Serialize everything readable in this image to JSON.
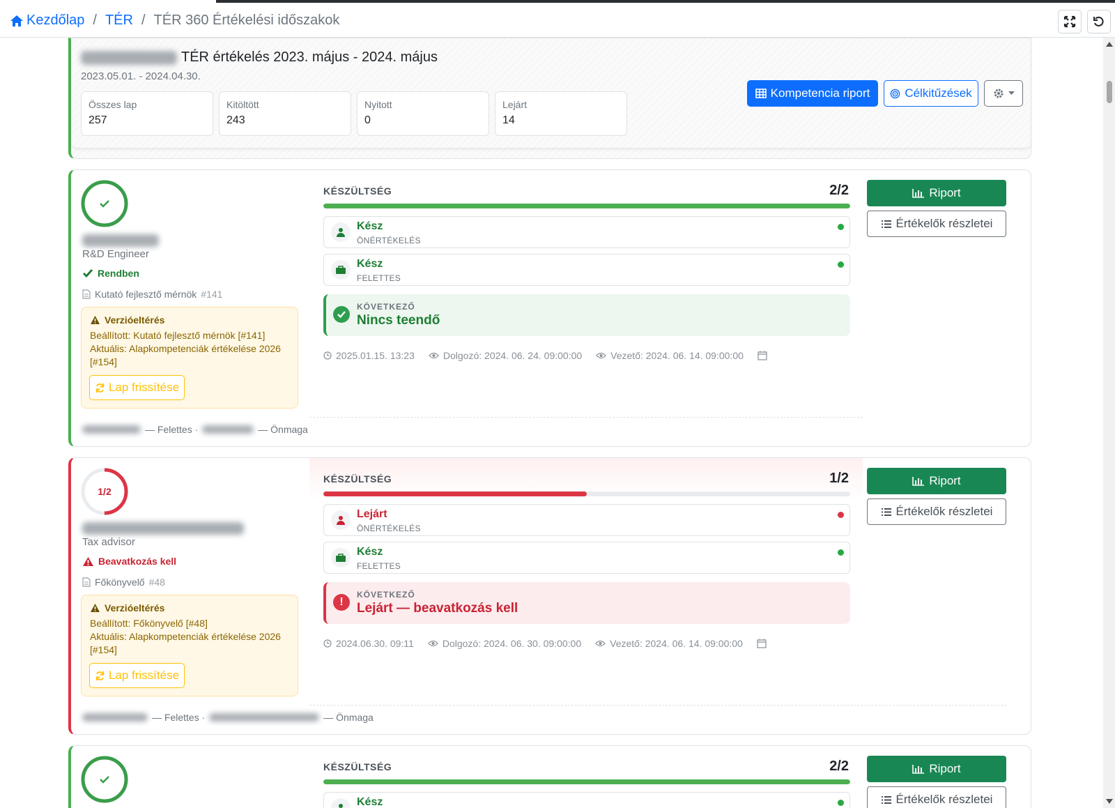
{
  "breadcrumb": {
    "home": "Kezdőlap",
    "ter": "TÉR",
    "current": "TÉR 360 Értékelési időszakok"
  },
  "period": {
    "title": "TÉR értékelés 2023. május - 2024. május",
    "dates": "2023.05.01. - 2024.04.30.",
    "stats": [
      {
        "label": "Összes lap",
        "value": "257"
      },
      {
        "label": "Kitöltött",
        "value": "243"
      },
      {
        "label": "Nyitott",
        "value": "0"
      },
      {
        "label": "Lejárt",
        "value": "14"
      }
    ],
    "competency_button": "Kompetencia riport",
    "goals_button": "Célkitűzések"
  },
  "cards": [
    {
      "ring_text": "",
      "progress_fraction": 1.0,
      "role": "R&D Engineer",
      "status": "Rendben",
      "sheet_name": "Kutató fejlesztő mérnök",
      "sheet_num": "#141",
      "warning_title": "Verzióeltérés",
      "warning_set": "Beállított: Kutató fejlesztő mérnök [#141]",
      "warning_current": "Aktuális: Alapkompetenciák értékelése 2026 [#154]",
      "refresh_label": "Lap frissítése",
      "footer_sup": "— Felettes ·",
      "footer_self": "— Önmaga",
      "readiness_label": "KÉSZÜLTSÉG",
      "readiness_count": "2/2",
      "steps": [
        {
          "status": "Kész",
          "type": "ÖNÉRTÉKELÉS"
        },
        {
          "status": "Kész",
          "type": "FELETTES"
        }
      ],
      "next_label": "KÖVETKEZŐ",
      "next_value": "Nincs teendő",
      "meta_updated": "2025.01.15. 13:23",
      "meta_employee": "Dolgozó:  2024. 06. 24. 09:00:00",
      "meta_manager": "Vezető:  2024. 06. 14. 09:00:00",
      "report_button": "Riport",
      "evaluators_button": "Értékelők részletei"
    },
    {
      "ring_text": "1/2",
      "progress_fraction": 0.5,
      "role": "Tax advisor",
      "status": "Beavatkozás kell",
      "sheet_name": "Főkönyvelő",
      "sheet_num": "#48",
      "warning_title": "Verzióeltérés",
      "warning_set": "Beállított: Főkönyvelő [#48]",
      "warning_current": "Aktuális: Alapkompetenciák értékelése 2026 [#154]",
      "refresh_label": "Lap frissítése",
      "footer_sup": "— Felettes ·",
      "footer_self": "— Önmaga",
      "readiness_label": "KÉSZÜLTSÉG",
      "readiness_count": "1/2",
      "steps": [
        {
          "status": "Lejárt",
          "type": "ÖNÉRTÉKELÉS"
        },
        {
          "status": "Kész",
          "type": "FELETTES"
        }
      ],
      "next_label": "KÖVETKEZŐ",
      "next_value": "Lejárt — beavatkozás kell",
      "meta_updated": "2024.06.30. 09:11",
      "meta_employee": "Dolgozó:  2024. 06. 30. 09:00:00",
      "meta_manager": "Vezető:  2024. 06. 14. 09:00:00",
      "report_button": "Riport",
      "evaluators_button": "Értékelők részletei"
    },
    {
      "ring_text": "",
      "progress_fraction": 1.0,
      "readiness_label": "KÉSZÜLTSÉG",
      "readiness_count": "2/2",
      "steps": [
        {
          "status": "Kész",
          "type": ""
        }
      ],
      "report_button": "Riport",
      "evaluators_button": "Értékelők részletei"
    }
  ],
  "colors": {
    "primary": "#0d6efd",
    "success": "#198754",
    "ok_green": "#4caf50",
    "danger": "#dc3545",
    "warning": "#ffc107"
  }
}
